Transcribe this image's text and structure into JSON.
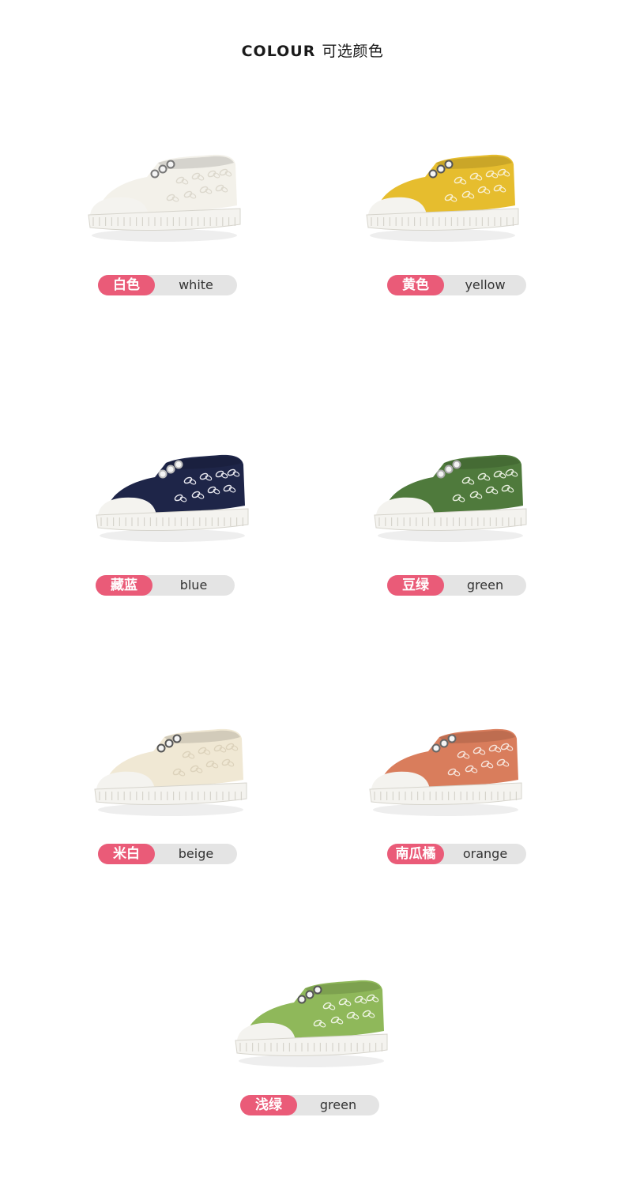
{
  "heading": {
    "en": "COLOUR",
    "zh": "可选颜色"
  },
  "colors": [
    {
      "cn": "白色",
      "en": "white",
      "upper": "#f3f1ea",
      "pattern": "#dcd8cd",
      "eyelet": "#777777"
    },
    {
      "cn": "黄色",
      "en": "yellow",
      "upper": "#e6bd2e",
      "pattern": "#f8efd0",
      "eyelet": "#555555"
    },
    {
      "cn": "藏蓝",
      "en": "blue",
      "upper": "#1e2548",
      "pattern": "#e8e8ef",
      "eyelet": "#bbbbbb"
    },
    {
      "cn": "豆绿",
      "en": "green",
      "upper": "#4f7a3c",
      "pattern": "#e6eddd",
      "eyelet": "#aaaaaa"
    },
    {
      "cn": "米白",
      "en": "beige",
      "upper": "#f0e8d4",
      "pattern": "#dcd2bb",
      "eyelet": "#555555"
    },
    {
      "cn": "南瓜橘",
      "en": "orange",
      "upper": "#d97d5c",
      "pattern": "#f6e3da",
      "eyelet": "#666666"
    },
    {
      "cn": "浅绿",
      "en": "green",
      "upper": "#8fb85a",
      "pattern": "#eef4e3",
      "eyelet": "#555555"
    }
  ],
  "style": {
    "tag_cn_bg": "#ea5b78",
    "tag_en_bg": "#e4e4e4",
    "sole": "#f4f3ef",
    "sole_line": "#d6d4cc"
  }
}
